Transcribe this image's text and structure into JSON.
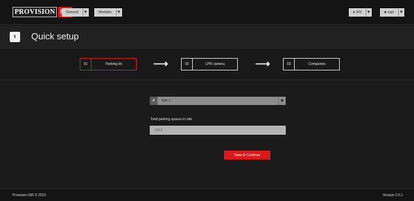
{
  "brand": {
    "logo_text": "PROVISION",
    "logo_badge": "ISR",
    "accent": "#e21b1b"
  },
  "topnav": {
    "general_label": "General",
    "modules_label": "Modules",
    "language_label": "EN",
    "user_label": "supi"
  },
  "header": {
    "title": "Quick setup"
  },
  "stepper": {
    "steps": [
      {
        "number": "01",
        "label": "Parking lot",
        "active": true
      },
      {
        "number": "02",
        "label": "LPR camera",
        "active": false
      },
      {
        "number": "03",
        "label": "Companies",
        "active": false
      }
    ]
  },
  "form": {
    "site_id": "#",
    "site_value": "Site 1",
    "total_label": "Total parking spaces in site",
    "total_placeholder": "9999",
    "save_label": "Save & Continue"
  },
  "footer": {
    "copyright": "Provision-ISR © 2023",
    "version": "Version 2.0.1"
  }
}
